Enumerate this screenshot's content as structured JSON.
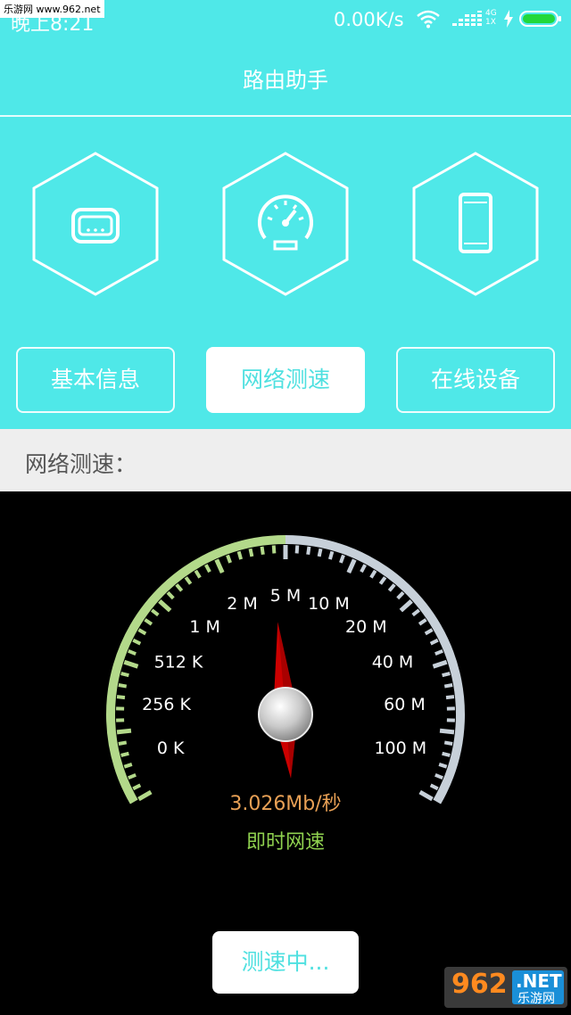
{
  "watermark": {
    "top_text": "乐游网 www.962.net",
    "logo_number": "962",
    "logo_suffix": ".NET",
    "logo_cn": "乐游网"
  },
  "status_bar": {
    "time": "晚上8:21",
    "speed": "0.00K/s",
    "net_type_top": "4G",
    "net_type_bottom": "1X"
  },
  "header": {
    "title": "路由助手"
  },
  "feature_icons": [
    {
      "name": "router-icon"
    },
    {
      "name": "speedometer-icon"
    },
    {
      "name": "phone-icon"
    }
  ],
  "tabs": {
    "basic_info": "基本信息",
    "speed_test": "网络测速",
    "online_devices": "在线设备",
    "active": "网络测速"
  },
  "section": {
    "label": "网络测速："
  },
  "gauge": {
    "scale_labels": [
      "0 K",
      "256 K",
      "512 K",
      "1 M",
      "2 M",
      "5 M",
      "10 M",
      "20 M",
      "40 M",
      "60 M",
      "100 M"
    ],
    "progress_color": "#b3d98a",
    "track_color": "#c7d0d9",
    "needle_color": "#cc0000",
    "needle_level_fraction": 0.48
  },
  "readout": {
    "value": "3.026Mb/秒",
    "label": "即时网速"
  },
  "action_button": {
    "label": "测速中..."
  },
  "colors": {
    "accent": "#4fe8e8",
    "section_bg": "#eeeeee",
    "readout": "#e8a055",
    "readout_label": "#8fd14f"
  }
}
